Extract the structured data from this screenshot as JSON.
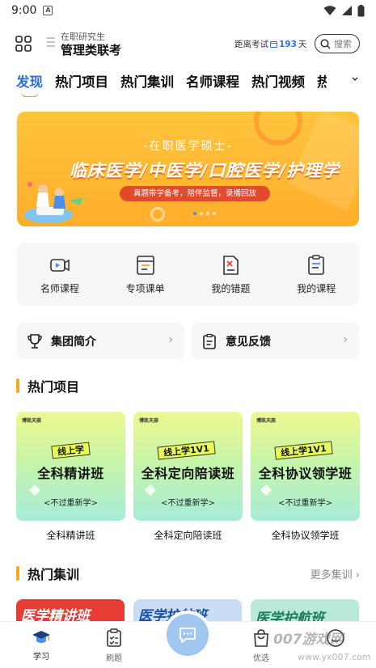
{
  "status_bar": {
    "time": "9:00",
    "notification_icon": "A"
  },
  "header": {
    "exam_subtitle": "在职研究生",
    "exam_title": "管理类联考",
    "countdown_prefix": "距离考试",
    "countdown_days": "193",
    "countdown_suffix": "天",
    "search_label": "搜索"
  },
  "tabs": [
    {
      "label": "发现",
      "active": true
    },
    {
      "label": "热门项目"
    },
    {
      "label": "热门集训"
    },
    {
      "label": "名师课程"
    },
    {
      "label": "热门视频"
    },
    {
      "label": "热"
    }
  ],
  "banner": {
    "subtitle": "-在职医学硕士-",
    "title": "临床医学/中医学/口腔医学/护理学",
    "pill": "真题带学备考，陪伴监督，录播回放",
    "dot_count": 4,
    "active_dot": 0
  },
  "quick_entries": [
    {
      "label": "名师课程",
      "icon": "video-icon"
    },
    {
      "label": "专项课单",
      "icon": "course-list-icon"
    },
    {
      "label": "我的错题",
      "icon": "wrong-questions-icon"
    },
    {
      "label": "我的课程",
      "icon": "my-courses-icon"
    }
  ],
  "cards": {
    "group_intro": "集团简介",
    "feedback": "意见反馈",
    "arrow": "›"
  },
  "hot_projects": {
    "title": "热门项目",
    "items": [
      {
        "brand": "博凯天辰",
        "tag": "线上学",
        "big": "全科精讲班",
        "small": "<不过重新学>",
        "name": "全科精讲班"
      },
      {
        "brand": "博凯天辰",
        "tag": "线上学1V1",
        "big": "全科定向陪读班",
        "small": "<不过重新学>",
        "name": "全科定向陪读班"
      },
      {
        "brand": "博凯天辰",
        "tag": "线上学1V1",
        "big": "全科协议领学班",
        "small": "<不过重新学>",
        "name": "全科协议领学班"
      }
    ]
  },
  "hot_training": {
    "title": "热门集训",
    "more": "更多集训 ›",
    "items": [
      {
        "text": "医学精讲班",
        "bg": "#e53c33",
        "fg": "#ffffff"
      },
      {
        "text": "医学护航班",
        "bg": "#c9def6",
        "fg": "#1a4fa0"
      },
      {
        "text": "医学护航班",
        "bg": "#b9ead9",
        "fg": "#1a7a5a"
      }
    ]
  },
  "bottom_nav": [
    {
      "label": "学习",
      "icon": "graduation-cap-icon",
      "active": true
    },
    {
      "label": "刷题",
      "icon": "clipboard-icon"
    },
    {
      "label": "",
      "icon": "chat-icon"
    },
    {
      "label": "优选",
      "icon": "shopping-bag-icon"
    },
    {
      "label": "",
      "icon": "profile-icon"
    }
  ],
  "watermark": {
    "main": "007游戏网",
    "sub": "www.yx007.com"
  },
  "colors": {
    "accent": "#2c6fd6",
    "highlight": "#f5a623",
    "banner": "#ffb52e"
  }
}
